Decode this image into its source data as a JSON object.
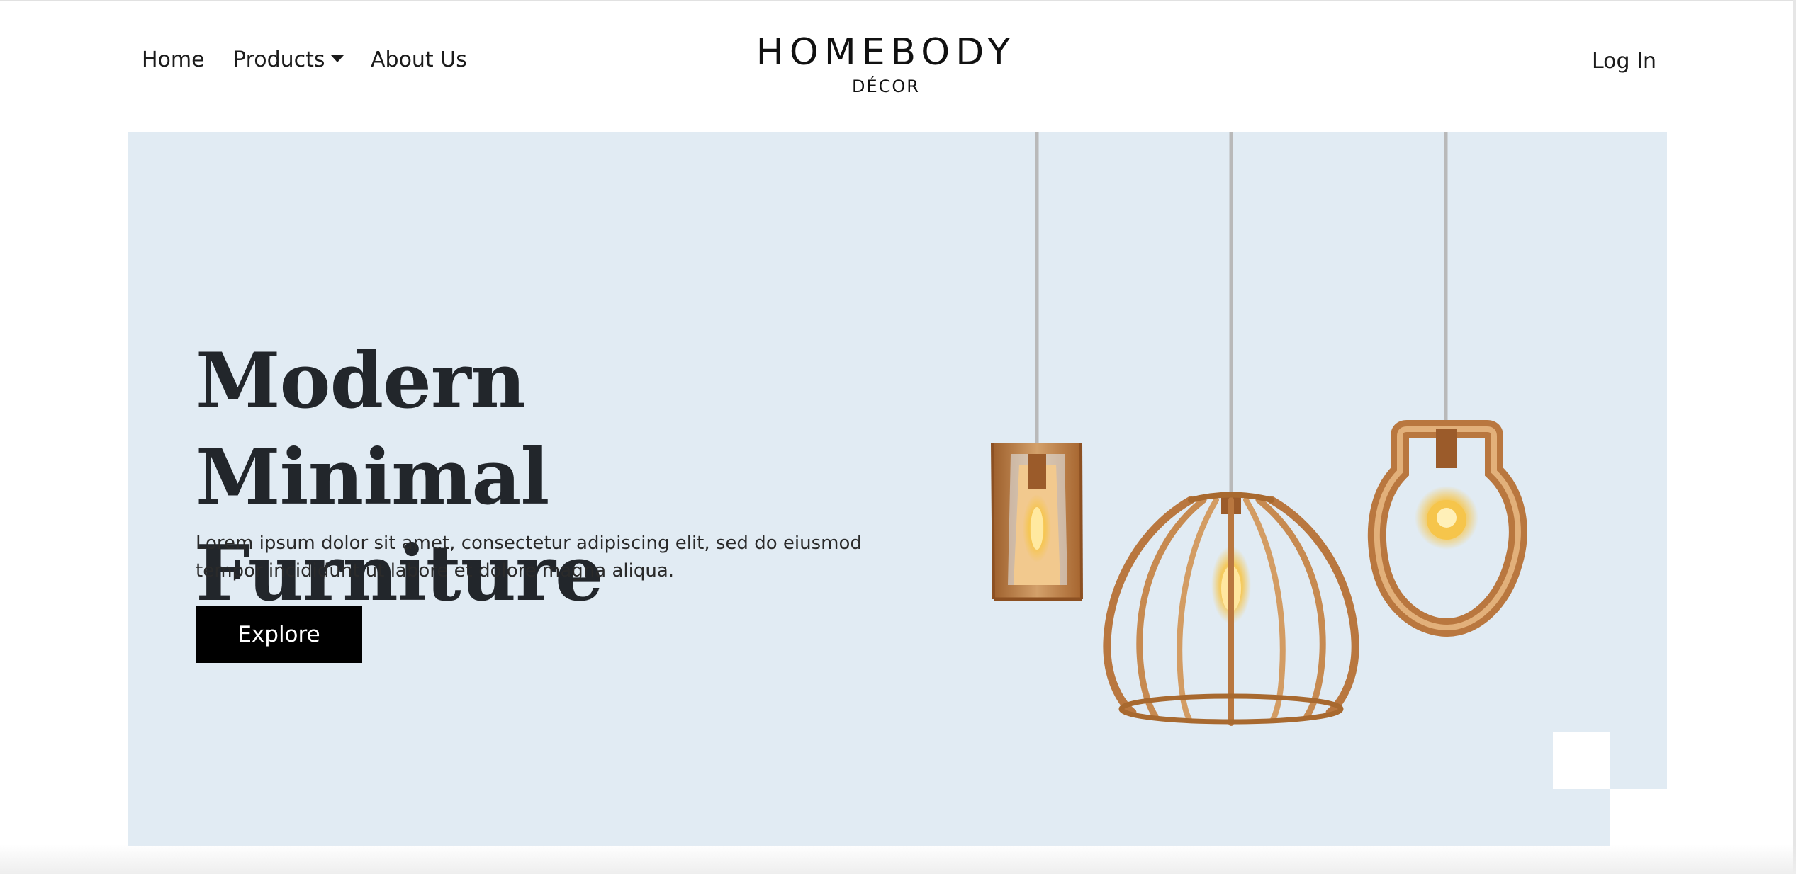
{
  "nav": {
    "home": "Home",
    "products": "Products",
    "about": "About Us",
    "login": "Log In"
  },
  "logo": {
    "main": "HOMEBODY",
    "sub": "DÉCOR"
  },
  "hero": {
    "title_line1": "Modern Minimal",
    "title_line2": "Furniture",
    "description_line1": "Lorem ipsum dolor sit amet, consectetur adipiscing elit, sed do eiusmod",
    "description_line2": "tempor incididunt ut labore et dolore magna aliqua.",
    "cta": "Explore"
  },
  "colors": {
    "hero_background": "#e1ebf3",
    "button": "#000000",
    "wood": "#b9773f",
    "bulb_glow": "#f6c54b"
  }
}
